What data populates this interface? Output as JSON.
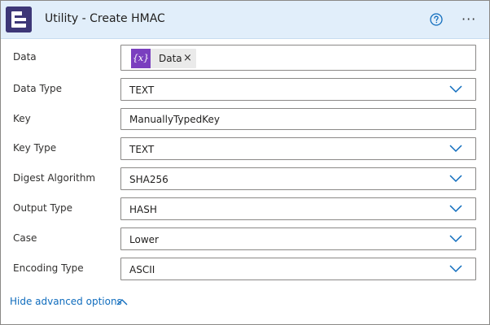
{
  "header": {
    "title": "Utility - Create HMAC",
    "app_icon": "encodian-logo-icon",
    "help_icon": "question-circle-icon",
    "more_icon": "ellipsis-icon",
    "more_glyph": "···",
    "background": "#e1eefa"
  },
  "fields": [
    {
      "label": "Data",
      "type": "token",
      "token_label": "Data",
      "token_icon_text": "{x}",
      "token_close": "×"
    },
    {
      "label": "Data Type",
      "type": "dropdown",
      "value": "TEXT"
    },
    {
      "label": "Key",
      "type": "text",
      "value": "ManuallyTypedKey"
    },
    {
      "label": "Key Type",
      "type": "dropdown",
      "value": "TEXT"
    },
    {
      "label": "Digest Algorithm",
      "type": "dropdown",
      "value": "SHA256"
    },
    {
      "label": "Output Type",
      "type": "dropdown",
      "value": "HASH"
    },
    {
      "label": "Case",
      "type": "dropdown",
      "value": "Lower"
    },
    {
      "label": "Encoding Type",
      "type": "dropdown",
      "value": "ASCII"
    }
  ],
  "advanced_options": {
    "label": "Hide advanced options"
  },
  "colors": {
    "accent": "#0f6cbd",
    "token_purple": "#7a3fbf",
    "app_icon_bg": "#3d3777"
  }
}
